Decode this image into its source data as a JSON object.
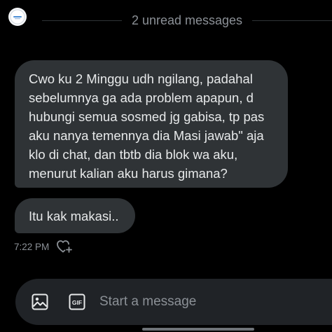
{
  "header": {
    "avatar_icon": "profile-logo-icon",
    "unread_label": "2 unread messages"
  },
  "messages": [
    {
      "lines": [
        "Cwo ku 2 Minggu udh ngilang, padahal",
        "sebelumnya ga ada problem apapun, d",
        "hubungi semua sosmed jg gabisa, tp pas",
        "aku nanya temennya dia Masi jawab\" aja",
        "klo di chat, dan tbtb dia blok wa aku,",
        "menurut kalian aku harus gimana?"
      ]
    },
    {
      "text": "Itu kak makasi.."
    }
  ],
  "meta": {
    "time": "7:22 PM",
    "react_icon": "heart-plus-icon"
  },
  "composer": {
    "placeholder": "Start a message",
    "image_icon": "image-icon",
    "gif_icon": "gif-icon"
  },
  "colors": {
    "background": "#000000",
    "bubble": "#2f3336",
    "composer": "#202327",
    "text": "#e7e9ea",
    "muted": "#8b9096"
  }
}
